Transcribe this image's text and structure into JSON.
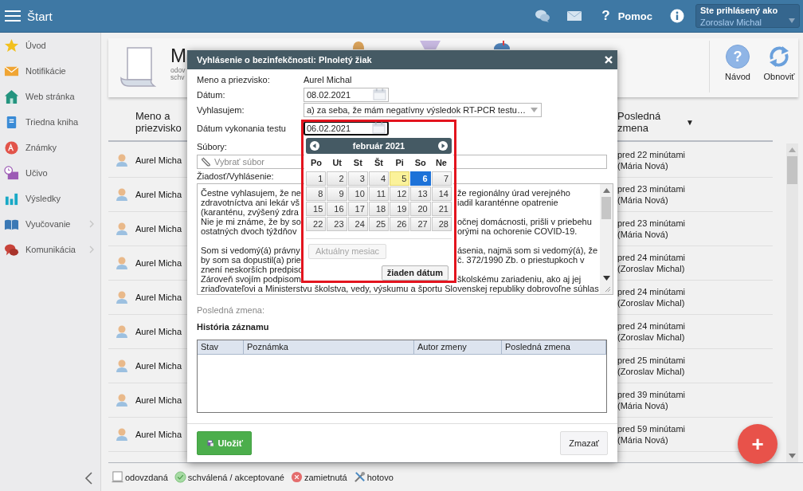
{
  "topbar": {
    "title": "Štart",
    "help_glyph": "?",
    "help_label": "Pomoc",
    "user_caption": "Ste prihlásený ako",
    "user_name": "Zoroslav Michal"
  },
  "sidebar": {
    "items": [
      {
        "label": "Úvod",
        "expandable": false
      },
      {
        "label": "Notifikácie",
        "expandable": false
      },
      {
        "label": "Web stránka",
        "expandable": false
      },
      {
        "label": "Triedna kniha",
        "expandable": false
      },
      {
        "label": "Známky",
        "expandable": false
      },
      {
        "label": "Učivo",
        "expandable": false
      },
      {
        "label": "Výsledky",
        "expandable": false
      },
      {
        "label": "Vyučovanie",
        "expandable": true
      },
      {
        "label": "Komunikácia",
        "expandable": true
      }
    ]
  },
  "header": {
    "title": "M",
    "subtitle_lines": [
      "odov",
      "schv"
    ]
  },
  "toolbar": [
    {
      "label": "Návod",
      "glyph": "?"
    },
    {
      "label": "Obnoviť"
    }
  ],
  "table": {
    "columns": [
      "Meno a priezvisko",
      "Posledná zmena"
    ],
    "sort_glyph": "▼",
    "rows": [
      {
        "name": "Aurel Micha",
        "changed": "pred 22 minútami",
        "author": "(Mária Nová)"
      },
      {
        "name": "Aurel Micha",
        "changed": "pred 23 minútami",
        "author": "(Mária Nová)"
      },
      {
        "name": "Aurel Micha",
        "changed": "pred 23 minútami",
        "author": "(Mária Nová)"
      },
      {
        "name": "Aurel Micha",
        "changed": "pred 24 minútami",
        "author": "(Zoroslav Michal)"
      },
      {
        "name": "Aurel Micha",
        "changed": "pred 24 minútami",
        "author": "(Zoroslav Michal)"
      },
      {
        "name": "Aurel Micha",
        "changed": "pred 24 minútami",
        "author": "(Zoroslav Michal)"
      },
      {
        "name": "Aurel Micha",
        "changed": "pred 25 minútami",
        "author": "(Zoroslav Michal)"
      },
      {
        "name": "Aurel Micha",
        "changed": "pred 39 minútami",
        "author": "(Mária Nová)"
      },
      {
        "name": "Aurel Micha",
        "changed": "pred 59 minútami",
        "author": "(Mária Nová)"
      }
    ]
  },
  "legend": [
    {
      "label": "odovzdaná"
    },
    {
      "label": "schválená / akceptované"
    },
    {
      "label": "zamietnutá"
    },
    {
      "label": "hotovo"
    }
  ],
  "fab": "+",
  "dialog": {
    "title": "Vyhlásenie o bezinfekčnosti: Plnoletý žiak",
    "fields": [
      {
        "kind": "text",
        "label": "Meno a priezvisko:",
        "value": "Aurel Michal"
      },
      {
        "kind": "date",
        "label": "Dátum:",
        "value": "08.02.2021",
        "focused": false
      },
      {
        "kind": "select",
        "label": "Vyhlasujem:",
        "value": "a) za seba, že mám negatívny výsledok RT-PCR testu…"
      },
      {
        "kind": "date",
        "label": "Dátum vykonania testu",
        "value": "06.02.2021",
        "focused": true
      }
    ],
    "files": {
      "label": "Súbory:",
      "placeholder": "Vybrať súbor"
    },
    "statement": {
      "label": "Žiadosť/Vyhlásenie:",
      "lines": [
        {
          "kind": "split",
          "left": "Čestne vyhlasujem, že ne",
          "right": "že regionálny úrad verejného"
        },
        {
          "kind": "split",
          "left": "zdravotníctva ani lekár vš",
          "right": "iadil karanténne opatrenie"
        },
        {
          "kind": "split",
          "left": "(karanténu, zvýšený zdra"
        },
        {
          "kind": "split",
          "left": "Nie je mi známe, že by so",
          "right": "očnej domácnosti, prišli v priebehu"
        },
        {
          "kind": "split",
          "left": "ostatných dvoch týždňov",
          "right": "orými na ochorenie COVID-19."
        },
        {
          "kind": "blank"
        },
        {
          "kind": "split",
          "left": "Som si vedomý(á) právny",
          "right": "ásenia, najmä som si vedomý(á), že"
        },
        {
          "kind": "split",
          "left": "by som sa dopustil(a) prie",
          "right": "č. 372/1990 Zb. o priestupkoch v"
        },
        {
          "kind": "split",
          "left": "znení neskorších predpiso"
        },
        {
          "kind": "split",
          "left": "Zároveň svojím podpisom",
          "right": "školskému zariadeniu, ako aj jej"
        },
        {
          "kind": "full",
          "text": "zriaďovateľovi a Ministerstvu školstva, vedy, výskumu a športu Slovenskej republiky dobrovoľne súhlas"
        }
      ]
    },
    "last_change_label": "Posledná zmena:",
    "history": {
      "title": "História záznamu",
      "columns": [
        "Stav",
        "Poznámka",
        "Autor zmeny",
        "Posledná zmena"
      ]
    },
    "buttons": [
      {
        "label": "Uložiť",
        "kind": "primary"
      },
      {
        "label": "Zmazať",
        "kind": "secondary"
      }
    ],
    "calendar": {
      "month": "február 2021",
      "weekdays": [
        "Po",
        "Ut",
        "St",
        "Št",
        "Pi",
        "So",
        "Ne"
      ],
      "days": [
        {
          "label": "1",
          "today": false,
          "selected": false
        },
        {
          "label": "2",
          "today": false,
          "selected": false
        },
        {
          "label": "3",
          "today": false,
          "selected": false
        },
        {
          "label": "4",
          "today": false,
          "selected": false
        },
        {
          "label": "5",
          "today": true,
          "selected": false
        },
        {
          "label": "6",
          "today": false,
          "selected": true
        },
        {
          "label": "7",
          "today": false,
          "selected": false
        },
        {
          "label": "8",
          "today": false,
          "selected": false
        },
        {
          "label": "9",
          "today": false,
          "selected": false
        },
        {
          "label": "10",
          "today": false,
          "selected": false
        },
        {
          "label": "11",
          "today": false,
          "selected": false
        },
        {
          "label": "12",
          "today": false,
          "selected": false
        },
        {
          "label": "13",
          "today": false,
          "selected": false
        },
        {
          "label": "14",
          "today": false,
          "selected": false
        },
        {
          "label": "15",
          "today": false,
          "selected": false
        },
        {
          "label": "16",
          "today": false,
          "selected": false
        },
        {
          "label": "17",
          "today": false,
          "selected": false
        },
        {
          "label": "18",
          "today": false,
          "selected": false
        },
        {
          "label": "19",
          "today": false,
          "selected": false
        },
        {
          "label": "20",
          "today": false,
          "selected": false
        },
        {
          "label": "21",
          "today": false,
          "selected": false
        },
        {
          "label": "22",
          "today": false,
          "selected": false
        },
        {
          "label": "23",
          "today": false,
          "selected": false
        },
        {
          "label": "24",
          "today": false,
          "selected": false
        },
        {
          "label": "25",
          "today": false,
          "selected": false
        },
        {
          "label": "26",
          "today": false,
          "selected": false
        },
        {
          "label": "27",
          "today": false,
          "selected": false
        },
        {
          "label": "28",
          "today": false,
          "selected": false
        }
      ],
      "current_month": {
        "label": "Aktuálny mesiac",
        "disabled": true
      },
      "clear": "žiaden dátum"
    }
  }
}
